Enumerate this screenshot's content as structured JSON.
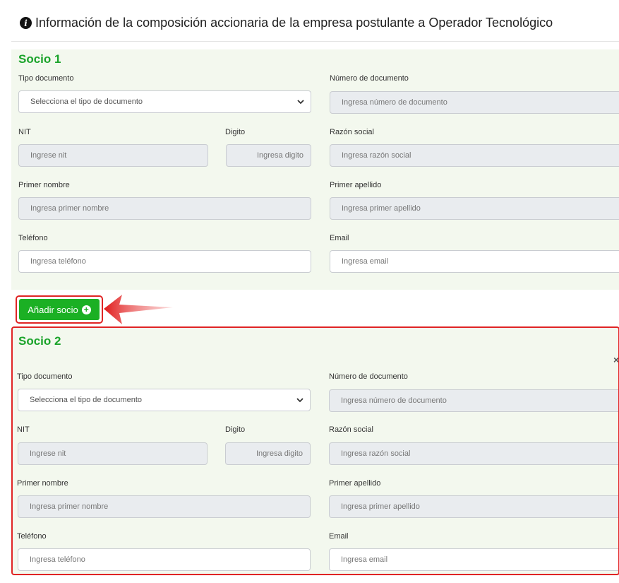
{
  "header": {
    "title": "Información de la composición accionaria de la empresa postulante a Operador Tecnológico",
    "icon": "info-icon"
  },
  "labels": {
    "tipo_documento": "Tipo documento",
    "numero_documento": "Número de documento",
    "nit": "NIT",
    "digito": "Digito",
    "razon_social": "Razón social",
    "primer_nombre": "Primer nombre",
    "primer_apellido": "Primer apellido",
    "telefono": "Teléfono",
    "email": "Email"
  },
  "placeholders": {
    "tipo_documento": "Selecciona el tipo de documento",
    "numero_documento": "Ingresa número de documento",
    "nit": "Ingrese nit",
    "digito": "Ingresa digito",
    "razon_social": "Ingresa razón social",
    "primer_nombre": "Ingresa primer nombre",
    "primer_apellido": "Ingresa  primer apellido",
    "telefono": "Ingresa teléfono",
    "email": "Ingresa email"
  },
  "socio1": {
    "title": "Socio 1"
  },
  "socio2": {
    "title": "Socio 2",
    "close": "×"
  },
  "add_button": {
    "label": "Añadir socio",
    "icon": "plus-circle-icon"
  },
  "colors": {
    "accent_green": "#1bb024",
    "title_green": "#1aa32a",
    "highlight_red": "#e02424",
    "card_bg": "#f3f8ee"
  }
}
